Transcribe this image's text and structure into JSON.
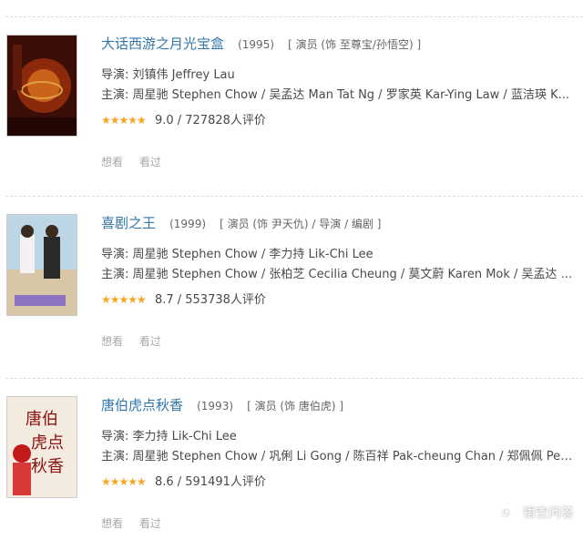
{
  "movies": [
    {
      "title": "大话西游之月光宝盒",
      "year": "(1995)",
      "role": "[ 演员 (饰 至尊宝/孙悟空) ]",
      "director": "导演: 刘镇伟 Jeffrey Lau",
      "cast": "主演: 周星驰 Stephen Chow / 吴孟达 Man Tat Ng / 罗家英 Kar-Ying Law / 蓝洁瑛 K...",
      "stars": "★★★★★",
      "rating": "9.0 / 727828人评价",
      "want": "想看",
      "seen": "看过"
    },
    {
      "title": "喜剧之王",
      "year": "(1999)",
      "role": "[ 演员 (饰 尹天仇) / 导演 / 编剧 ]",
      "director": "导演: 周星驰 Stephen Chow / 李力持 Lik-Chi Lee",
      "cast": "主演: 周星驰 Stephen Chow / 张柏芝 Cecilia Cheung / 莫文蔚 Karen Mok / 吴孟达 ...",
      "stars": "★★★★★",
      "rating": "8.7 / 553738人评价",
      "want": "想看",
      "seen": "看过"
    },
    {
      "title": "唐伯虎点秋香",
      "year": "(1993)",
      "role": "[ 演员 (饰 唐伯虎) ]",
      "director": "导演: 李力持 Lik-Chi Lee",
      "cast": "主演: 周星驰 Stephen Chow / 巩俐 Li Gong / 陈百祥 Pak-cheung Chan / 郑佩佩 Pei...",
      "stars": "★★★★★",
      "rating": "8.6 / 591491人评价",
      "want": "想看",
      "seen": "看过"
    }
  ],
  "watermark": {
    "text": "悟空问答"
  },
  "colors": {
    "title": "#3377aa",
    "star": "#f5a623"
  }
}
